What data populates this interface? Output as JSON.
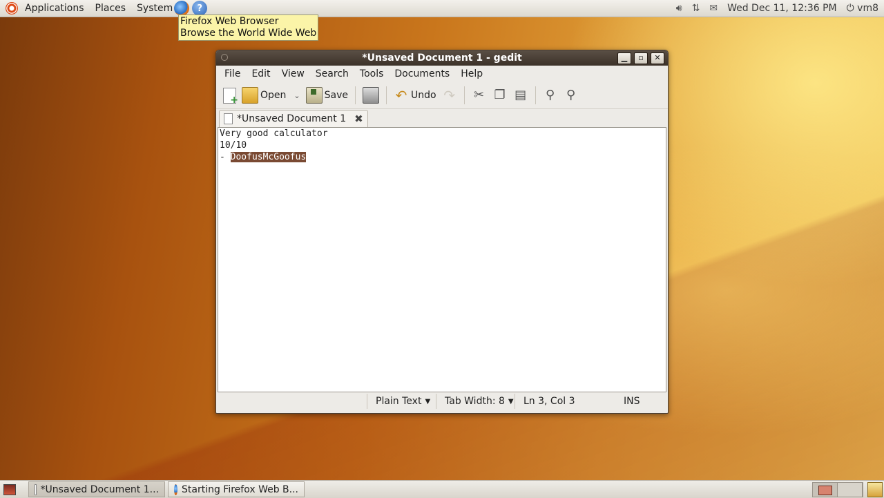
{
  "top_panel": {
    "menus": [
      "Applications",
      "Places",
      "System"
    ],
    "clock": "Wed Dec 11, 12:36 PM",
    "user": "vm8",
    "icons": [
      "ubuntu-logo-icon",
      "firefox-launcher-icon",
      "help-icon",
      "volume-icon",
      "network-icon",
      "mail-icon",
      "power-icon"
    ]
  },
  "tooltip": {
    "title": "Firefox Web Browser",
    "subtitle": "Browse the World Wide Web"
  },
  "window": {
    "title": "*Unsaved Document 1 - gedit",
    "menu": [
      "File",
      "Edit",
      "View",
      "Search",
      "Tools",
      "Documents",
      "Help"
    ],
    "toolbar": {
      "open_label": "Open",
      "save_label": "Save",
      "undo_label": "Undo"
    },
    "tab": {
      "label": "*Unsaved Document 1"
    },
    "editor": {
      "line1": "Very good calculator",
      "line2": "10/10",
      "line3_prefix": "- ",
      "line3_selected": "DoofusMcGoofus"
    },
    "status": {
      "language": "Plain Text",
      "tab_width_label": "Tab Width:",
      "tab_width": "8",
      "position": "Ln 3, Col 3",
      "mode": "INS"
    }
  },
  "bottom_panel": {
    "tasks": [
      "*Unsaved Document 1...",
      "Starting Firefox Web B..."
    ]
  },
  "colors": {
    "selection": "#7a4a33",
    "titlebar": "#3c3229",
    "tooltip_bg": "#fbf4a8"
  }
}
